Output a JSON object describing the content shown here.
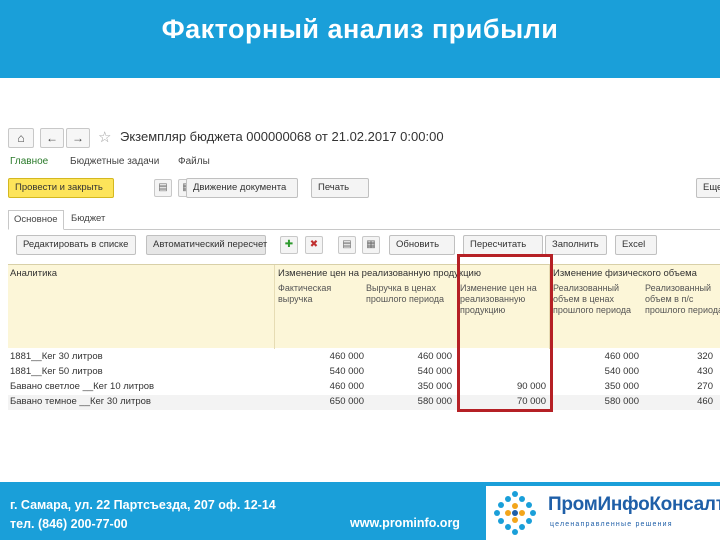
{
  "slide": {
    "title": "Факторный анализ прибыли"
  },
  "window": {
    "document_title": "Экземпляр бюджета 000000068 от 21.02.2017 0:00:00"
  },
  "menu": [
    "Главное",
    "Бюджетные задачи",
    "Файлы"
  ],
  "toolbar": {
    "post_and_close": "Провести и закрыть",
    "doc_movement": "Движение документа",
    "print": "Печать",
    "more": "Еще"
  },
  "tabs": [
    "Основное",
    "Бюджет"
  ],
  "table_toolbar": {
    "edit_in_list": "Редактировать в списке",
    "auto_recalc": "Автоматический пересчет",
    "refresh": "Обновить",
    "recalc": "Пересчитать",
    "fill": "Заполнить",
    "excel": "Excel"
  },
  "table": {
    "col_analytics": "Аналитика",
    "group1": "Изменение цен на реализованную продукцию",
    "group2": "Изменение физического объема",
    "sub1": "Фактическая выручка",
    "sub2": "Выручка в ценах прошлого периода",
    "sub3": "Изменение цен на реализованную продукцию",
    "sub4": "Реализованный объем в ценах прошлого периода",
    "sub5": "Реализованный объем в п/с прошлого периода",
    "rows": [
      {
        "name": "1881__Кег 30 литров",
        "c1": "460 000",
        "c2": "460 000",
        "c3": "",
        "c4": "460 000",
        "c5": "320"
      },
      {
        "name": "1881__Кег 50 литров",
        "c1": "540 000",
        "c2": "540 000",
        "c3": "",
        "c4": "540 000",
        "c5": "430"
      },
      {
        "name": "Бавано светлое __Кег 10 литров",
        "c1": "460 000",
        "c2": "350 000",
        "c3": "90 000",
        "c4": "350 000",
        "c5": "270"
      },
      {
        "name": "Бавано темное __Кег 30 литров",
        "c1": "650 000",
        "c2": "580 000",
        "c3": "70 000",
        "c4": "580 000",
        "c5": "460"
      }
    ]
  },
  "footer": {
    "address_line1": "г. Самара, ул. 22 Партсъезда, 207 оф. 12-14",
    "address_line2": "тел. (846) 200-77-00",
    "website": "www.prominfo.org",
    "logo_name": "ПромИнфоКонсалт",
    "logo_tagline": "целенаправленные решения"
  },
  "colors": {
    "brand_blue": "#1a9fd9",
    "highlight_red": "#b52025",
    "primary_button": "#fde45a"
  }
}
